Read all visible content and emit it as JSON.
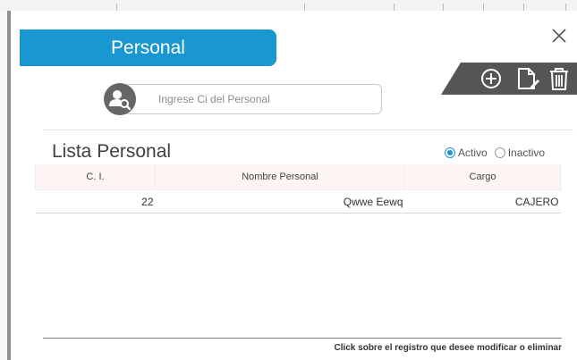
{
  "dialog": {
    "title": "Personal",
    "close_icon": "close-icon"
  },
  "toolbar": {
    "icons": [
      "add-circle-icon",
      "edit-document-icon",
      "trash-icon"
    ]
  },
  "search": {
    "icon": "user-search-icon",
    "placeholder": "Ingrese Ci del Personal"
  },
  "list": {
    "title": "Lista Personal",
    "filters": [
      {
        "label": "Activo",
        "selected": true
      },
      {
        "label": "Inactivo",
        "selected": false
      }
    ],
    "columns": [
      "C. I.",
      "Nombre Personal",
      "Cargo"
    ],
    "rows": [
      {
        "ci": "22",
        "nombre": "Qwwe Eewq",
        "cargo": "CAJERO"
      }
    ]
  },
  "footer": {
    "hint": "Click  sobre el registro que desee modificar o eliminar"
  },
  "colors": {
    "accent": "#1997d1",
    "toolbar_bg": "#555555",
    "avatar_bg": "#666666"
  }
}
